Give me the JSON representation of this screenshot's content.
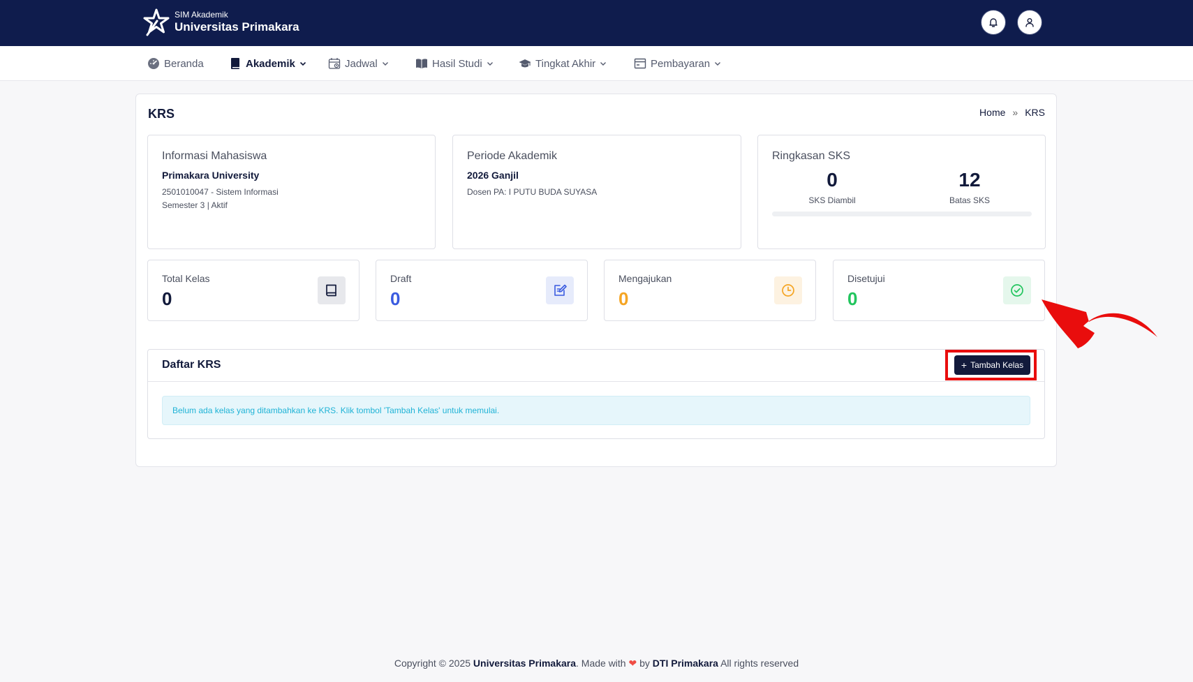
{
  "topbar": {
    "brand_sub": "SIM Akademik",
    "brand_main": "Universitas Primakara",
    "icons": [
      "bell-icon",
      "user-icon"
    ]
  },
  "nav": [
    {
      "label": "Beranda",
      "icon": "dashboard-icon",
      "dropdown": false,
      "active": false
    },
    {
      "label": "Akademik",
      "icon": "book-icon",
      "dropdown": true,
      "active": true
    },
    {
      "label": "Jadwal",
      "icon": "calendar-icon",
      "dropdown": true,
      "active": false
    },
    {
      "label": "Hasil Studi",
      "icon": "open-book-icon",
      "dropdown": true,
      "active": false
    },
    {
      "label": "Tingkat Akhir",
      "icon": "graduation-cap-icon",
      "dropdown": true,
      "active": false
    },
    {
      "label": "Pembayaran",
      "icon": "payment-card-icon",
      "dropdown": true,
      "active": false
    }
  ],
  "page": {
    "title": "KRS",
    "breadcrumb": {
      "home": "Home",
      "separator": "»",
      "current": "KRS"
    }
  },
  "student": {
    "title": "Informasi Mahasiswa",
    "name": "Primakara University",
    "id_program": "2501010047 - Sistem Informasi",
    "semester_status": "Semester 3 | Aktif"
  },
  "period": {
    "title": "Periode Akademik",
    "term": "2026 Ganjil",
    "advisor": "Dosen PA: I PUTU BUDA SUYASA"
  },
  "sks": {
    "title": "Ringkasan SKS",
    "taken_value": "0",
    "taken_label": "SKS Diambil",
    "limit_value": "12",
    "limit_label": "Batas SKS",
    "progress_fraction": 0
  },
  "stats": [
    {
      "label": "Total Kelas",
      "value": "0",
      "color": "#121a3b",
      "icon": "book-icon",
      "icon_bg": "#e7e8ec"
    },
    {
      "label": "Draft",
      "value": "0",
      "color": "#3a5be0",
      "icon": "edit-icon",
      "icon_bg": "#e6ebfb"
    },
    {
      "label": "Mengajukan",
      "value": "0",
      "color": "#f5a524",
      "icon": "clock-icon",
      "icon_bg": "#fdf2e1"
    },
    {
      "label": "Disetujui",
      "value": "0",
      "color": "#22c55e",
      "icon": "check-circle-icon",
      "icon_bg": "#e5f7ec"
    }
  ],
  "krs_list": {
    "title": "Daftar KRS",
    "add_button": "Tambah Kelas",
    "empty_message": "Belum ada kelas yang ditambahkan ke KRS. Klik tombol 'Tambah Kelas' untuk memulai."
  },
  "footer": {
    "prefix": "Copyright © 2025 ",
    "org": "Universitas Primakara",
    "made_with": ". Made with ",
    "heart": "❤",
    "by": " by ",
    "team": "DTI Primakara",
    "suffix": " All rights reserved"
  },
  "colors": {
    "topbar": "#0f1c4d",
    "primary_button": "#121a3b",
    "highlight": "#e90d0d",
    "info_text": "#1fb3d6"
  }
}
